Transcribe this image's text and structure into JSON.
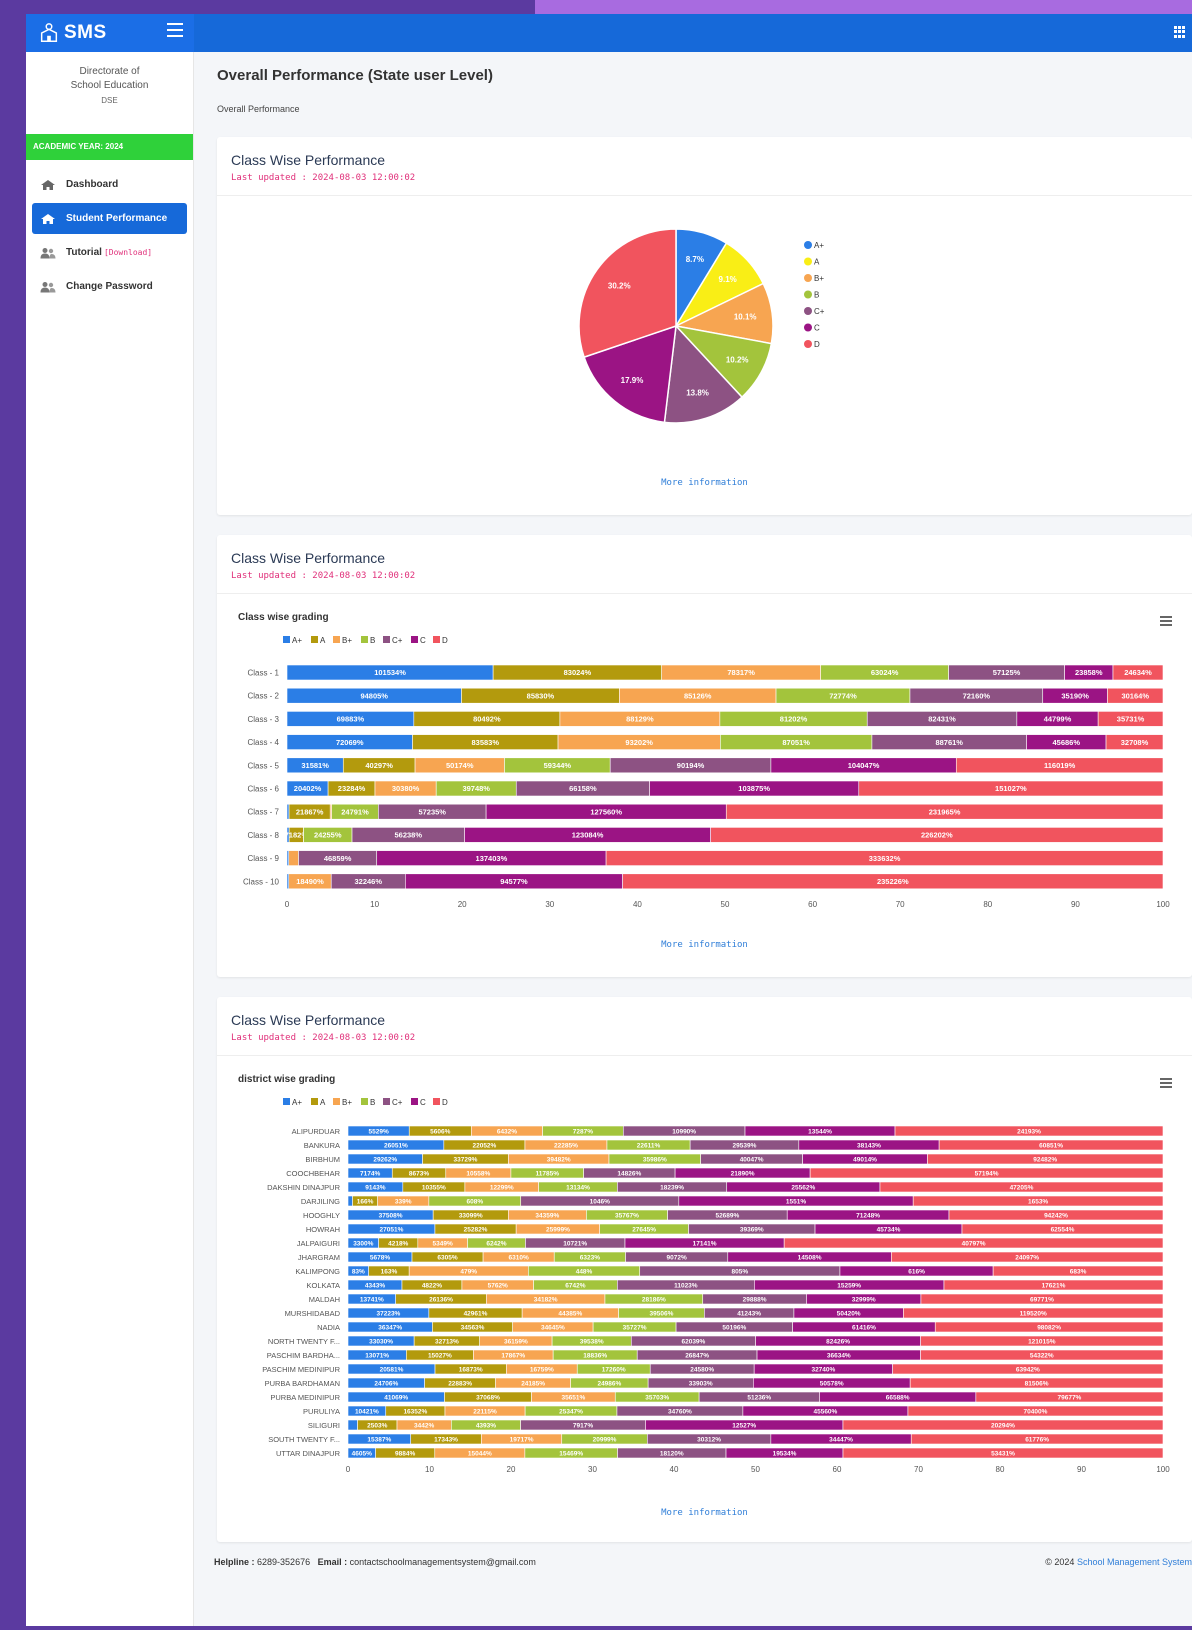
{
  "brand": {
    "name": "SMS"
  },
  "sidebar": {
    "org_line1": "Directorate of",
    "org_line2": "School Education",
    "org_short": "DSE",
    "academic_year": "ACADEMIC YEAR: 2024",
    "items": [
      {
        "label": "Dashboard",
        "icon": "home-icon"
      },
      {
        "label": "Student Performance",
        "icon": "home-icon",
        "active": true
      },
      {
        "label": "Tutorial",
        "extra": "[Download]",
        "icon": "users-icon"
      },
      {
        "label": "Change Password",
        "icon": "users-icon"
      }
    ]
  },
  "page": {
    "title": "Overall Performance (State user Level)",
    "breadcrumb": "Overall Performance"
  },
  "cards": [
    {
      "title": "Class Wise Performance",
      "updated": "Last updated : 2024-08-03 12:00:02",
      "more": "More information"
    },
    {
      "title": "Class Wise Performance",
      "updated": "Last updated : 2024-08-03 12:00:02",
      "more": "More information",
      "chart_title": "Class wise grading"
    },
    {
      "title": "Class Wise Performance",
      "updated": "Last updated : 2024-08-03 12:00:02",
      "more": "More information",
      "chart_title": "district wise grading"
    }
  ],
  "footer": {
    "helpline_label": "Helpline :",
    "helpline": "6289-352676",
    "email_label": "Email :",
    "email": "contactschoolmanagementsystem@gmail.com",
    "copyright": "© 2024",
    "system": "School Management System"
  },
  "colors": {
    "A+": "#2b7ee6",
    "A": "#b39a0d",
    "B+": "#f7a551",
    "B": "#a3c43c",
    "C+": "#8d5283",
    "C": "#9b1484",
    "D": "#f1545e",
    "pie_A": "#f9ee16"
  },
  "chart_data": [
    {
      "type": "pie",
      "series": [
        {
          "labels": [
            "A+",
            "A",
            "B+",
            "B",
            "C+",
            "C",
            "D"
          ],
          "values": [
            8.7,
            9.1,
            10.1,
            10.2,
            13.8,
            17.9,
            30.2
          ]
        }
      ],
      "legend": "right"
    },
    {
      "type": "bar",
      "title": "Class wise grading",
      "stacked": "percent",
      "orientation": "horizontal",
      "grades": [
        "A+",
        "A",
        "B+",
        "B",
        "C+",
        "C",
        "D"
      ],
      "categories": [
        "Class - 1",
        "Class - 2",
        "Class - 3",
        "Class - 4",
        "Class - 5",
        "Class - 6",
        "Class - 7",
        "Class - 8",
        "Class - 9",
        "Class - 10"
      ],
      "values": [
        [
          101534,
          83024,
          78317,
          63024,
          57125,
          23858,
          24634
        ],
        [
          94805,
          85830,
          85126,
          72774,
          72160,
          35190,
          30164
        ],
        [
          69883,
          80492,
          88129,
          81202,
          82431,
          44799,
          35731
        ],
        [
          72069,
          83583,
          93202,
          87051,
          88761,
          45686,
          32708
        ],
        [
          31581,
          40297,
          50174,
          59344,
          90194,
          104047,
          116019
        ],
        [
          20402,
          23284,
          30380,
          39748,
          66158,
          103875,
          151027
        ],
        [
          1089,
          21867,
          767,
          24791,
          57235,
          127560,
          231965
        ],
        [
          1071,
          7182,
          11,
          24255,
          56238,
          123084,
          226202
        ],
        [
          1044,
          0,
          5849,
          0,
          46859,
          137403,
          333632
        ],
        [
          764,
          0,
          18490,
          0,
          32246,
          94577,
          235226
        ]
      ],
      "xlim": [
        0,
        100
      ],
      "xticks": [
        0,
        10,
        20,
        30,
        40,
        50,
        60,
        70,
        80,
        90,
        100
      ],
      "legend": "top-left"
    },
    {
      "type": "bar",
      "title": "district wise grading",
      "stacked": "percent",
      "orientation": "horizontal",
      "grades": [
        "A+",
        "A",
        "B+",
        "B",
        "C+",
        "C",
        "D"
      ],
      "categories": [
        "ALIPURDUAR",
        "BANKURA",
        "BIRBHUM",
        "COOCHBEHAR",
        "DAKSHIN DINAJPUR",
        "DARJILING",
        "HOOGHLY",
        "HOWRAH",
        "JALPAIGURI",
        "JHARGRAM",
        "KALIMPONG",
        "KOLKATA",
        "MALDAH",
        "MURSHIDABAD",
        "NADIA",
        "NORTH TWENTY F...",
        "PASCHIM BARDHA...",
        "PASCHIM MEDINIPUR",
        "PURBA BARDHAMAN",
        "PURBA MEDINIPUR",
        "PURULIYA",
        "SILIGURI",
        "SOUTH TWENTY F...",
        "UTTAR DINAJPUR"
      ],
      "values": [
        [
          5529,
          5606,
          6432,
          7287,
          10990,
          13544,
          24193
        ],
        [
          26051,
          22052,
          22285,
          22611,
          29539,
          38143,
          60851
        ],
        [
          29262,
          33729,
          39482,
          35986,
          40047,
          49014,
          92482
        ],
        [
          7174,
          8673,
          10558,
          11785,
          14826,
          21890,
          57194
        ],
        [
          9143,
          10355,
          12299,
          13134,
          18239,
          25562,
          47205
        ],
        [
          30,
          166,
          339,
          608,
          1046,
          1551,
          1653
        ],
        [
          37508,
          33099,
          34359,
          35767,
          52689,
          71248,
          94242
        ],
        [
          27051,
          25282,
          25999,
          27645,
          39369,
          45734,
          62554
        ],
        [
          3300,
          4218,
          5349,
          6242,
          10721,
          17141,
          40797
        ],
        [
          5678,
          6305,
          6310,
          6323,
          9072,
          14508,
          24097
        ],
        [
          83,
          163,
          479,
          448,
          805,
          616,
          683
        ],
        [
          4343,
          4822,
          5762,
          6742,
          11023,
          15259,
          17621
        ],
        [
          13741,
          26136,
          34182,
          28186,
          29888,
          32999,
          69771
        ],
        [
          37223,
          42961,
          44385,
          39506,
          41243,
          50420,
          119520
        ],
        [
          36347,
          34563,
          34645,
          35727,
          50196,
          61416,
          98082
        ],
        [
          33030,
          32713,
          36159,
          39538,
          62039,
          82426,
          121015
        ],
        [
          13071,
          15027,
          17867,
          18836,
          26847,
          36634,
          54322
        ],
        [
          20581,
          16873,
          16759,
          17260,
          24580,
          32740,
          63942
        ],
        [
          24706,
          22883,
          24185,
          24986,
          33903,
          50578,
          81506
        ],
        [
          41069,
          37068,
          35651,
          35703,
          51236,
          66588,
          79677
        ],
        [
          10421,
          16352,
          22115,
          25347,
          34760,
          45560,
          70400
        ],
        [
          606,
          2503,
          3442,
          4393,
          7917,
          12527,
          20294
        ],
        [
          15387,
          17343,
          19717,
          20999,
          30312,
          34447,
          61776
        ],
        [
          4605,
          9884,
          15044,
          15469,
          18120,
          19534,
          53431
        ]
      ],
      "xlim": [
        0,
        100
      ],
      "xticks": [
        0,
        10,
        20,
        30,
        40,
        50,
        60,
        70,
        80,
        90,
        100
      ],
      "legend": "top-left"
    }
  ]
}
